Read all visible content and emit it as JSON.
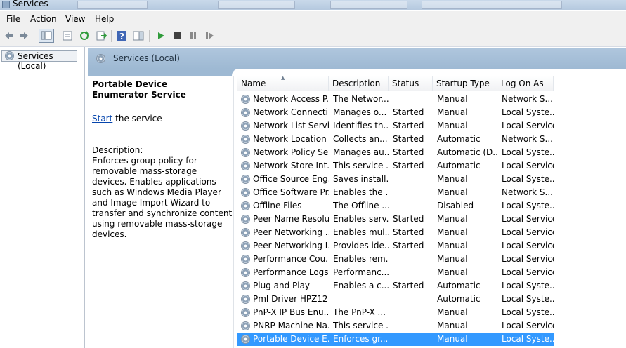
{
  "window": {
    "title": "Services"
  },
  "menu": [
    "File",
    "Action",
    "View",
    "Help"
  ],
  "tree": {
    "item": "Services (Local)"
  },
  "header": {
    "title": "Services (Local)"
  },
  "description_panel": {
    "service_name": "Portable Device Enumerator Service",
    "action_link": "Start",
    "action_suffix": " the service",
    "description_label": "Description:",
    "description_text": "Enforces group policy for removable mass-storage devices. Enables applications such as Windows Media Player and Image Import Wizard to transfer and synchronize content using removable mass-storage devices."
  },
  "columns": [
    "Name",
    "Description",
    "Status",
    "Startup Type",
    "Log On As"
  ],
  "rows": [
    {
      "name": "Network Access P...",
      "description": "The Networ...",
      "status": "",
      "startup": "Manual",
      "logon": "Network S..."
    },
    {
      "name": "Network Connecti...",
      "description": "Manages o...",
      "status": "Started",
      "startup": "Manual",
      "logon": "Local Syste..."
    },
    {
      "name": "Network List Service",
      "description": "Identifies th...",
      "status": "Started",
      "startup": "Manual",
      "logon": "Local Service"
    },
    {
      "name": "Network Location ...",
      "description": "Collects an...",
      "status": "Started",
      "startup": "Automatic",
      "logon": "Network S..."
    },
    {
      "name": "Network Policy Se...",
      "description": "Manages au...",
      "status": "Started",
      "startup": "Automatic (D...",
      "logon": "Local Syste..."
    },
    {
      "name": "Network Store Int...",
      "description": "This service ...",
      "status": "Started",
      "startup": "Automatic",
      "logon": "Local Service"
    },
    {
      "name": "Office  Source Eng...",
      "description": "Saves install...",
      "status": "",
      "startup": "Manual",
      "logon": "Local Syste..."
    },
    {
      "name": "Office Software Pr...",
      "description": "Enables the ...",
      "status": "",
      "startup": "Manual",
      "logon": "Network S..."
    },
    {
      "name": "Offline Files",
      "description": "The Offline ...",
      "status": "",
      "startup": "Disabled",
      "logon": "Local Syste..."
    },
    {
      "name": "Peer Name Resolu...",
      "description": "Enables serv...",
      "status": "Started",
      "startup": "Manual",
      "logon": "Local Service"
    },
    {
      "name": "Peer Networking ...",
      "description": "Enables mul...",
      "status": "Started",
      "startup": "Manual",
      "logon": "Local Service"
    },
    {
      "name": "Peer Networking I...",
      "description": "Provides ide...",
      "status": "Started",
      "startup": "Manual",
      "logon": "Local Service"
    },
    {
      "name": "Performance Cou...",
      "description": "Enables rem...",
      "status": "",
      "startup": "Manual",
      "logon": "Local Service"
    },
    {
      "name": "Performance Logs...",
      "description": "Performanc...",
      "status": "",
      "startup": "Manual",
      "logon": "Local Service"
    },
    {
      "name": "Plug and Play",
      "description": "Enables a c...",
      "status": "Started",
      "startup": "Automatic",
      "logon": "Local Syste..."
    },
    {
      "name": "Pml Driver HPZ12",
      "description": "",
      "status": "",
      "startup": "Automatic",
      "logon": "Local Syste..."
    },
    {
      "name": "PnP-X IP Bus Enu...",
      "description": "The PnP-X ...",
      "status": "",
      "startup": "Manual",
      "logon": "Local Syste..."
    },
    {
      "name": "PNRP Machine Na...",
      "description": "This service ...",
      "status": "",
      "startup": "Manual",
      "logon": "Local Service"
    },
    {
      "name": "Portable Device E...",
      "description": "Enforces gr...",
      "status": "",
      "startup": "Manual",
      "logon": "Local Syste...",
      "selected": true
    }
  ],
  "colors": {
    "selection": "#3399ff",
    "header": "#9eb9d3",
    "link": "#0645ad"
  }
}
